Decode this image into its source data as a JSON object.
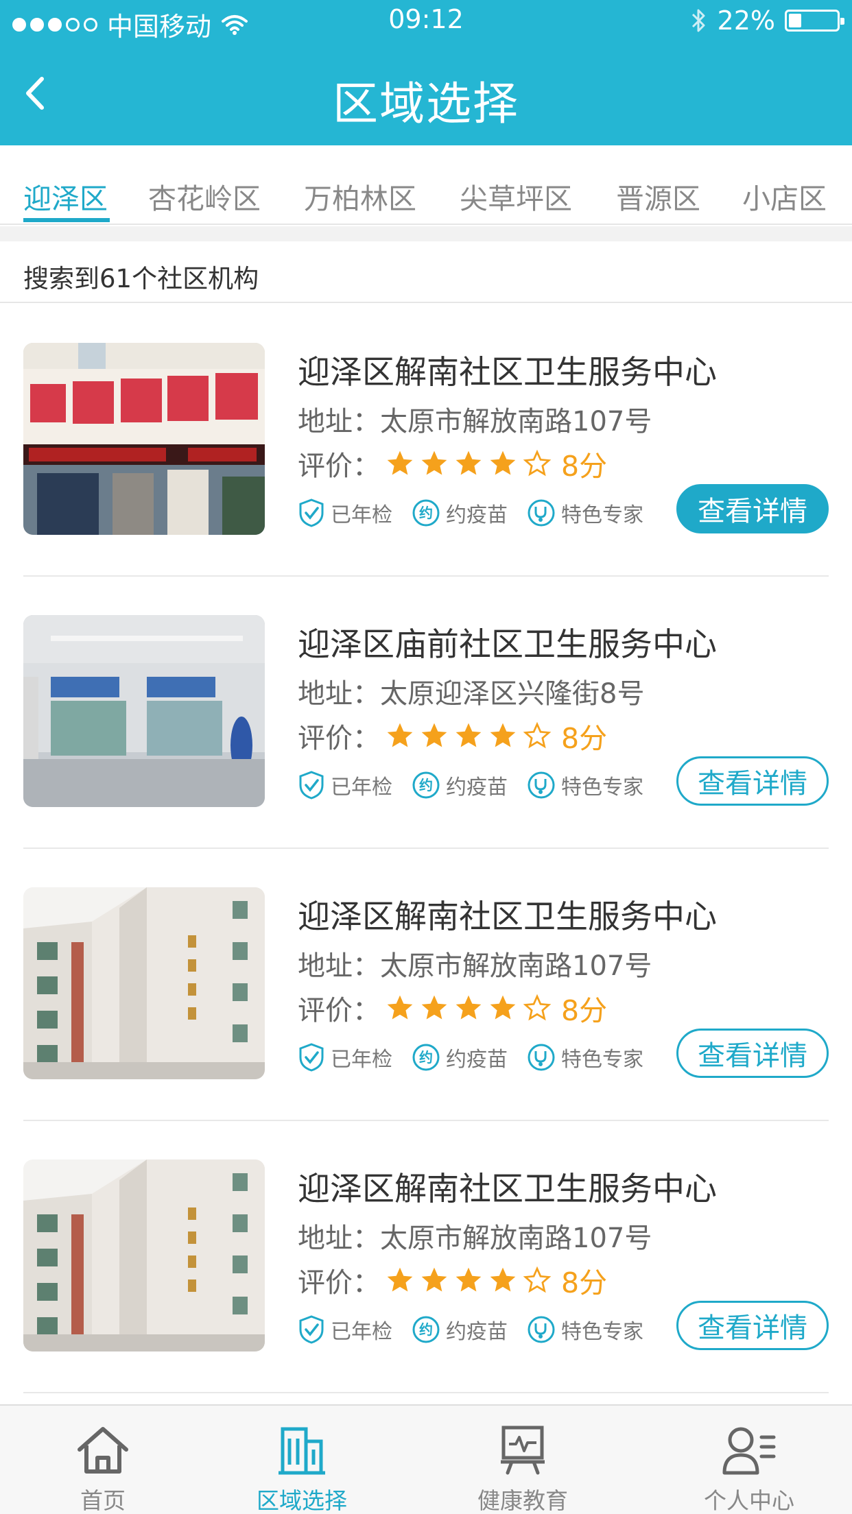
{
  "status_bar": {
    "carrier": "中国移动",
    "time": "09:12",
    "battery": "22%"
  },
  "header": {
    "title": "区域选择",
    "back_icon": "chevron-left-icon"
  },
  "tabs": [
    {
      "label": "迎泽区",
      "active": true
    },
    {
      "label": "杏花岭区",
      "active": false
    },
    {
      "label": "万柏林区",
      "active": false
    },
    {
      "label": "尖草坪区",
      "active": false
    },
    {
      "label": "晋源区",
      "active": false
    },
    {
      "label": "小店区",
      "active": false
    }
  ],
  "result_summary": "搜索到61个社区机构",
  "centers": [
    {
      "name": "迎泽区解南社区卫生服务中心",
      "address": "地址：太原市解放南路107号",
      "rating_label": "评价：",
      "stars": 4,
      "stars_max": 5,
      "score": "8分",
      "tags": [
        "已年检",
        "约疫苗",
        "特色专家"
      ],
      "button": "查看详情",
      "button_highlighted": true
    },
    {
      "name": "迎泽区庙前社区卫生服务中心",
      "address": "地址：太原迎泽区兴隆街8号",
      "rating_label": "评价：",
      "stars": 4,
      "stars_max": 5,
      "score": "8分",
      "tags": [
        "已年检",
        "约疫苗",
        "特色专家"
      ],
      "button": "查看详情",
      "button_highlighted": false
    },
    {
      "name": "迎泽区解南社区卫生服务中心",
      "address": "地址：太原市解放南路107号",
      "rating_label": "评价：",
      "stars": 4,
      "stars_max": 5,
      "score": "8分",
      "tags": [
        "已年检",
        "约疫苗",
        "特色专家"
      ],
      "button": "查看详情",
      "button_highlighted": false
    },
    {
      "name": "迎泽区解南社区卫生服务中心",
      "address": "地址：太原市解放南路107号",
      "rating_label": "评价：",
      "stars": 4,
      "stars_max": 5,
      "score": "8分",
      "tags": [
        "已年检",
        "约疫苗",
        "特色专家"
      ],
      "button": "查看详情",
      "button_highlighted": false
    }
  ],
  "bottom_nav": [
    {
      "label": "首页",
      "icon": "home-icon",
      "active": false
    },
    {
      "label": "区域选择",
      "icon": "building-icon",
      "active": true
    },
    {
      "label": "健康教育",
      "icon": "presentation-board-icon",
      "active": false
    },
    {
      "label": "个人中心",
      "icon": "user-profile-icon",
      "active": false
    }
  ],
  "colors": {
    "primary": "#25b6d3",
    "accent": "#1fa9c9",
    "star": "#f5a11c"
  }
}
